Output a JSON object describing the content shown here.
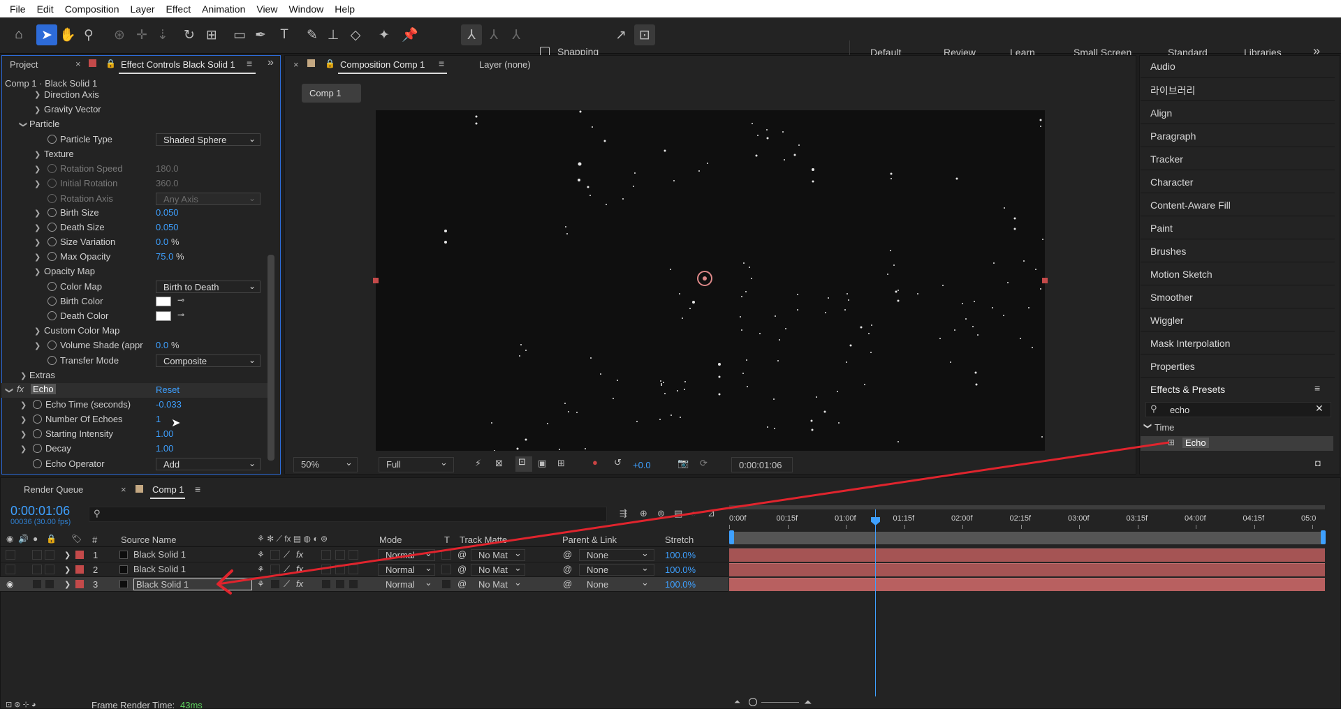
{
  "menu": [
    "File",
    "Edit",
    "Composition",
    "Layer",
    "Effect",
    "Animation",
    "View",
    "Window",
    "Help"
  ],
  "toolbar": {
    "snapping_label": "Snapping",
    "workspaces": [
      "Default",
      "Review",
      "Learn",
      "Small Screen",
      "Standard",
      "Libraries"
    ],
    "more": "»"
  },
  "left_panel": {
    "tab_project": "Project",
    "tab_effect_controls": "Effect Controls Black Solid 1",
    "layer_path": "Comp 1 · Black Solid 1",
    "rows": {
      "direction_axis": "Direction Axis",
      "gravity_vector": "Gravity Vector",
      "particle": "Particle",
      "particle_type": "Particle Type",
      "particle_type_val": "Shaded Sphere",
      "texture": "Texture",
      "rotation_speed": "Rotation Speed",
      "rotation_speed_val": "180.0",
      "initial_rotation": "Initial Rotation",
      "initial_rotation_val": "360.0",
      "rotation_axis": "Rotation Axis",
      "rotation_axis_val": "Any Axis",
      "birth_size": "Birth Size",
      "birth_size_val": "0.050",
      "death_size": "Death Size",
      "death_size_val": "0.050",
      "size_variation": "Size Variation",
      "size_variation_val": "0.0",
      "max_opacity": "Max Opacity",
      "max_opacity_val": "75.0",
      "pct": "%",
      "opacity_map": "Opacity Map",
      "color_map": "Color Map",
      "color_map_val": "Birth to Death",
      "birth_color": "Birth Color",
      "death_color": "Death Color",
      "custom_color_map": "Custom Color Map",
      "volume_shade": "Volume Shade (appr",
      "volume_shade_val": "0.0",
      "transfer_mode": "Transfer Mode",
      "transfer_mode_val": "Composite",
      "extras": "Extras",
      "fx": "fx",
      "echo": "Echo",
      "reset": "Reset",
      "echo_time": "Echo Time (seconds)",
      "echo_time_val": "-0.033",
      "number_of_echoes": "Number Of Echoes",
      "number_of_echoes_val": "1",
      "starting_intensity": "Starting Intensity",
      "starting_intensity_val": "1.00",
      "decay": "Decay",
      "decay_val": "1.00",
      "echo_operator": "Echo Operator",
      "echo_operator_val": "Add"
    }
  },
  "comp_panel": {
    "tab_comp": "Composition Comp 1",
    "tab_layer": "Layer (none)",
    "breadcrumb": "Comp 1",
    "zoom": "50%",
    "resolution": "Full",
    "exposure": "+0.0",
    "timecode": "0:00:01:06"
  },
  "right_panel": {
    "items": [
      "Audio",
      "라이브러리",
      "Align",
      "Paragraph",
      "Tracker",
      "Character",
      "Content-Aware Fill",
      "Paint",
      "Brushes",
      "Motion Sketch",
      "Smoother",
      "Wiggler",
      "Mask Interpolation",
      "Properties"
    ],
    "effects_title": "Effects & Presets",
    "search_value": "echo",
    "category": "Time",
    "result": "Echo"
  },
  "timeline": {
    "tab_render_queue": "Render Queue",
    "tab_comp": "Comp 1",
    "timecode": "0:00:01:06",
    "frames": "00036 (30.00 fps)",
    "columns": {
      "num": "#",
      "source_name": "Source Name",
      "mode": "Mode",
      "t": "T",
      "track_matte": "Track Matte",
      "parent_link": "Parent & Link",
      "stretch": "Stretch"
    },
    "ruler": [
      "0:00f",
      "00:15f",
      "01:00f",
      "01:15f",
      "02:00f",
      "02:15f",
      "03:00f",
      "03:15f",
      "04:00f",
      "04:15f",
      "05:0"
    ],
    "layers": [
      {
        "num": "1",
        "name": "Black Solid 1",
        "mode": "Normal",
        "matte": "No Mat",
        "parent": "None",
        "stretch": "100.0%"
      },
      {
        "num": "2",
        "name": "Black Solid 1",
        "mode": "Normal",
        "matte": "No Mat",
        "parent": "None",
        "stretch": "100.0%"
      },
      {
        "num": "3",
        "name": "Black Solid 1",
        "mode": "Normal",
        "matte": "No Mat",
        "parent": "None",
        "stretch": "100.0%"
      }
    ],
    "frame_render_label": "Frame Render Time:",
    "frame_render_value": "43ms"
  },
  "colors": {
    "accent_blue": "#3ea0ff",
    "label_red": "#c44a4a",
    "arrow_red": "#e0242d"
  }
}
